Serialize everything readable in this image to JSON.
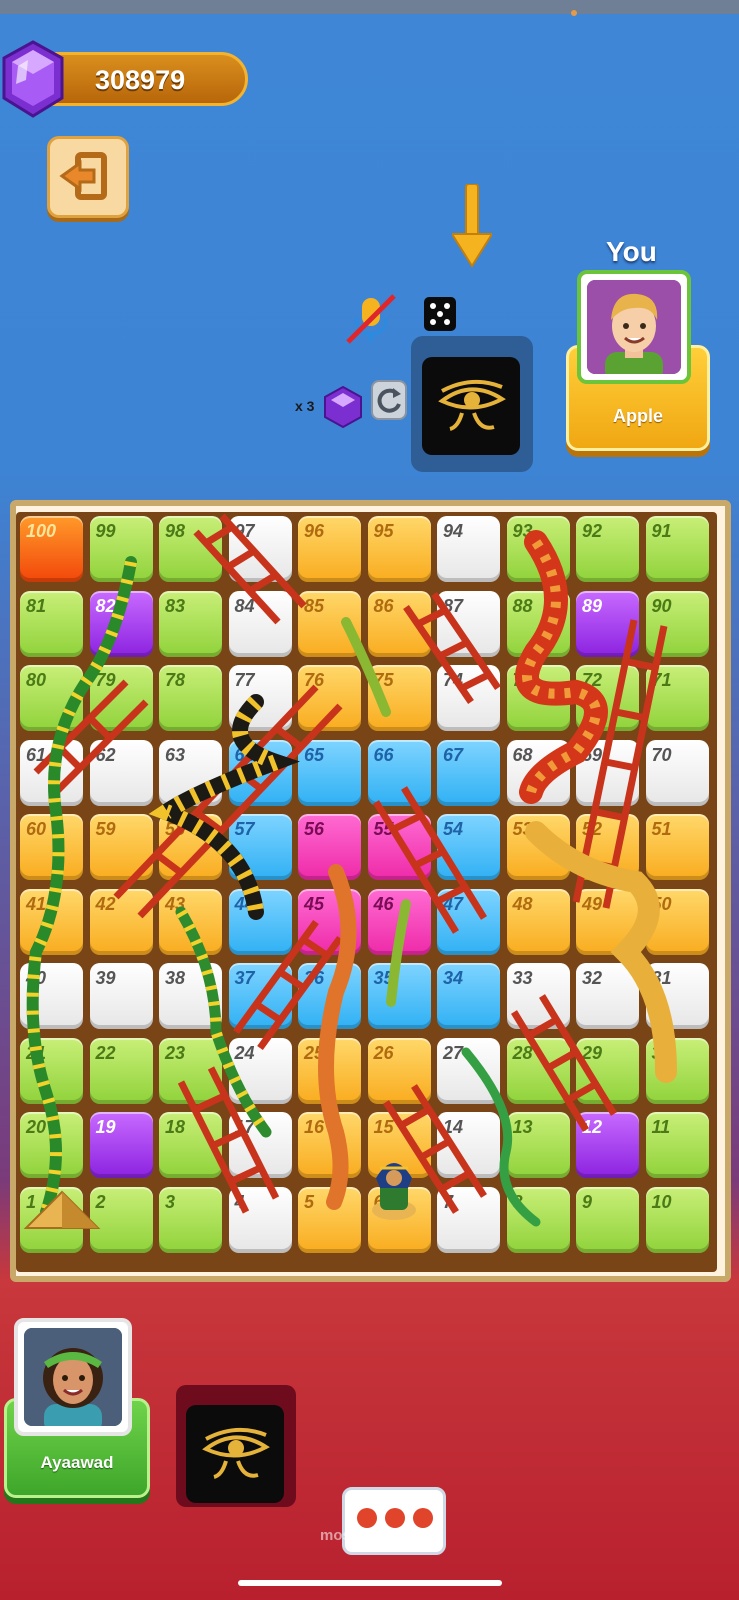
{
  "hud": {
    "gems": "308979",
    "you_label": "You",
    "reroll_multiplier": "x 3",
    "icons": {
      "gem": "gem-icon",
      "exit": "exit-door-icon",
      "turn_arrow": "down-arrow-icon",
      "mic_muted": "mic-muted-icon",
      "dice": "dice-icon",
      "reroll": "refresh-icon",
      "eye_of_horus": "eye-of-horus-icon",
      "chat": "chat-bubble-icon"
    }
  },
  "players": {
    "top": {
      "name": "Apple",
      "role": "You"
    },
    "bottom": {
      "name": "Ayaawad"
    }
  },
  "board": {
    "rows": [
      [
        {
          "n": "100",
          "c": "red"
        },
        {
          "n": "99",
          "c": "green"
        },
        {
          "n": "98",
          "c": "green"
        },
        {
          "n": "97",
          "c": "white"
        },
        {
          "n": "96",
          "c": "orange"
        },
        {
          "n": "95",
          "c": "orange"
        },
        {
          "n": "94",
          "c": "white"
        },
        {
          "n": "93",
          "c": "green"
        },
        {
          "n": "92",
          "c": "green"
        },
        {
          "n": "91",
          "c": "green"
        }
      ],
      [
        {
          "n": "81",
          "c": "green"
        },
        {
          "n": "82",
          "c": "purple"
        },
        {
          "n": "83",
          "c": "green"
        },
        {
          "n": "84",
          "c": "white"
        },
        {
          "n": "85",
          "c": "orange"
        },
        {
          "n": "86",
          "c": "orange"
        },
        {
          "n": "87",
          "c": "white"
        },
        {
          "n": "88",
          "c": "green"
        },
        {
          "n": "89",
          "c": "purple"
        },
        {
          "n": "90",
          "c": "green"
        }
      ],
      [
        {
          "n": "80",
          "c": "green"
        },
        {
          "n": "79",
          "c": "green"
        },
        {
          "n": "78",
          "c": "green"
        },
        {
          "n": "77",
          "c": "white"
        },
        {
          "n": "76",
          "c": "orange"
        },
        {
          "n": "75",
          "c": "orange"
        },
        {
          "n": "74",
          "c": "white"
        },
        {
          "n": "73",
          "c": "green"
        },
        {
          "n": "72",
          "c": "green"
        },
        {
          "n": "71",
          "c": "green"
        }
      ],
      [
        {
          "n": "61",
          "c": "white"
        },
        {
          "n": "62",
          "c": "white"
        },
        {
          "n": "63",
          "c": "white"
        },
        {
          "n": "64",
          "c": "blue"
        },
        {
          "n": "65",
          "c": "blue"
        },
        {
          "n": "66",
          "c": "blue"
        },
        {
          "n": "67",
          "c": "blue"
        },
        {
          "n": "68",
          "c": "white"
        },
        {
          "n": "69",
          "c": "white"
        },
        {
          "n": "70",
          "c": "white"
        }
      ],
      [
        {
          "n": "60",
          "c": "orange"
        },
        {
          "n": "59",
          "c": "orange"
        },
        {
          "n": "58",
          "c": "orange"
        },
        {
          "n": "57",
          "c": "blue"
        },
        {
          "n": "56",
          "c": "pink"
        },
        {
          "n": "55",
          "c": "pink"
        },
        {
          "n": "54",
          "c": "blue"
        },
        {
          "n": "53",
          "c": "orange"
        },
        {
          "n": "52",
          "c": "orange"
        },
        {
          "n": "51",
          "c": "orange"
        }
      ],
      [
        {
          "n": "41",
          "c": "orange"
        },
        {
          "n": "42",
          "c": "orange"
        },
        {
          "n": "43",
          "c": "orange"
        },
        {
          "n": "44",
          "c": "blue"
        },
        {
          "n": "45",
          "c": "pink"
        },
        {
          "n": "46",
          "c": "pink"
        },
        {
          "n": "47",
          "c": "blue"
        },
        {
          "n": "48",
          "c": "orange"
        },
        {
          "n": "49",
          "c": "orange"
        },
        {
          "n": "50",
          "c": "orange"
        }
      ],
      [
        {
          "n": "40",
          "c": "white"
        },
        {
          "n": "39",
          "c": "white"
        },
        {
          "n": "38",
          "c": "white"
        },
        {
          "n": "37",
          "c": "blue"
        },
        {
          "n": "36",
          "c": "blue"
        },
        {
          "n": "35",
          "c": "blue"
        },
        {
          "n": "34",
          "c": "blue"
        },
        {
          "n": "33",
          "c": "white"
        },
        {
          "n": "32",
          "c": "white"
        },
        {
          "n": "31",
          "c": "white"
        }
      ],
      [
        {
          "n": "21",
          "c": "green"
        },
        {
          "n": "22",
          "c": "green"
        },
        {
          "n": "23",
          "c": "green"
        },
        {
          "n": "24",
          "c": "white"
        },
        {
          "n": "25",
          "c": "orange"
        },
        {
          "n": "26",
          "c": "orange"
        },
        {
          "n": "27",
          "c": "white"
        },
        {
          "n": "28",
          "c": "green"
        },
        {
          "n": "29",
          "c": "green"
        },
        {
          "n": "30",
          "c": "green"
        }
      ],
      [
        {
          "n": "20",
          "c": "green"
        },
        {
          "n": "19",
          "c": "purple"
        },
        {
          "n": "18",
          "c": "green"
        },
        {
          "n": "17",
          "c": "white"
        },
        {
          "n": "16",
          "c": "orange"
        },
        {
          "n": "15",
          "c": "orange"
        },
        {
          "n": "14",
          "c": "white"
        },
        {
          "n": "13",
          "c": "green"
        },
        {
          "n": "12",
          "c": "purple"
        },
        {
          "n": "11",
          "c": "green"
        }
      ],
      [
        {
          "n": "1",
          "c": "green"
        },
        {
          "n": "2",
          "c": "green"
        },
        {
          "n": "3",
          "c": "green"
        },
        {
          "n": "4",
          "c": "white"
        },
        {
          "n": "5",
          "c": "orange"
        },
        {
          "n": "6",
          "c": "orange"
        },
        {
          "n": "7",
          "c": "white"
        },
        {
          "n": "8",
          "c": "green"
        },
        {
          "n": "9",
          "c": "green"
        },
        {
          "n": "10",
          "c": "green"
        }
      ]
    ]
  },
  "watermark": "mostaql.com"
}
